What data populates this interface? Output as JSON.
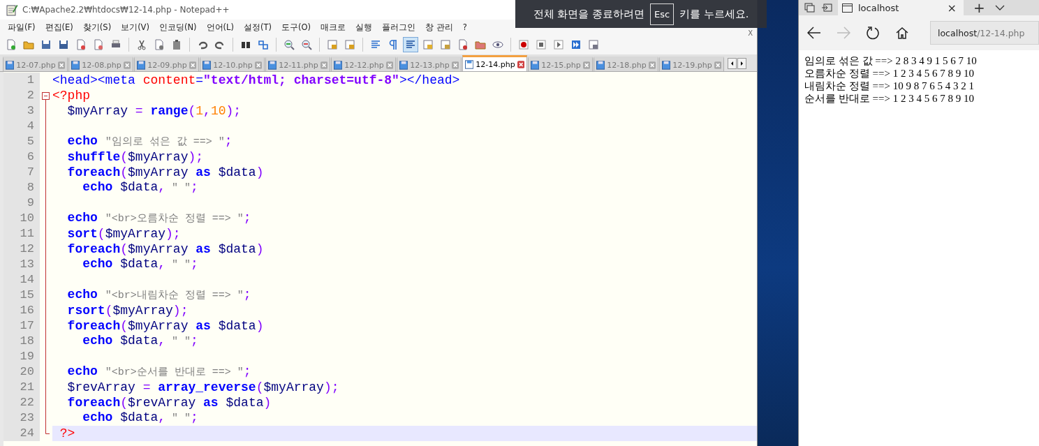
{
  "editor_window": {
    "title": "C:₩Apache2.2₩htdocs₩12-14.php - Notepad++",
    "menu": [
      "파일(F)",
      "편집(E)",
      "찾기(S)",
      "보기(V)",
      "인코딩(N)",
      "언어(L)",
      "설정(T)",
      "도구(O)",
      "매크로",
      "실행",
      "플러그인",
      "창 관리",
      "?"
    ],
    "close_document": "X",
    "tabs": [
      {
        "label": "12-07.php",
        "selected": false
      },
      {
        "label": "12-08.php",
        "selected": false
      },
      {
        "label": "12-09.php",
        "selected": false
      },
      {
        "label": "12-10.php",
        "selected": false
      },
      {
        "label": "12-11.php",
        "selected": false
      },
      {
        "label": "12-12.php",
        "selected": false
      },
      {
        "label": "12-13.php",
        "selected": false
      },
      {
        "label": "12-14.php",
        "selected": true
      },
      {
        "label": "12-15.php",
        "selected": false
      },
      {
        "label": "12-18.php",
        "selected": false
      },
      {
        "label": "12-19.php",
        "selected": false
      }
    ],
    "lines": [
      {
        "number": "1",
        "current": false,
        "code": [
          {
            "text": "<head><meta ",
            "kind": "tag"
          },
          {
            "text": "content",
            "kind": "attr"
          },
          {
            "text": "=",
            "kind": "tag"
          },
          {
            "text": "\"text/html; charset=utf-8\"",
            "kind": "aval"
          },
          {
            "text": "></head>",
            "kind": "tag"
          }
        ]
      },
      {
        "number": "2",
        "current": false,
        "code": [
          {
            "text": "<?php",
            "kind": "php"
          }
        ]
      },
      {
        "number": "3",
        "current": false,
        "code": [
          {
            "text": "  $myArray ",
            "kind": "var"
          },
          {
            "text": "= ",
            "kind": "op"
          },
          {
            "text": "range",
            "kind": "kw"
          },
          {
            "text": "(",
            "kind": "op"
          },
          {
            "text": "1",
            "kind": "num"
          },
          {
            "text": ",",
            "kind": "op"
          },
          {
            "text": "10",
            "kind": "num"
          },
          {
            "text": ");",
            "kind": "op"
          }
        ]
      },
      {
        "number": "4",
        "current": false
      },
      {
        "number": "5",
        "current": false,
        "code": [
          {
            "text": "  echo ",
            "kind": "kw"
          },
          {
            "text": "\"임의로 섞은 값 ==> \"",
            "kind": "str"
          },
          {
            "text": ";",
            "kind": "op"
          }
        ]
      },
      {
        "number": "6",
        "current": false,
        "code": [
          {
            "text": "  shuffle",
            "kind": "kw"
          },
          {
            "text": "(",
            "kind": "op"
          },
          {
            "text": "$myArray",
            "kind": "var"
          },
          {
            "text": ");",
            "kind": "op"
          }
        ]
      },
      {
        "number": "7",
        "current": false,
        "code": [
          {
            "text": "  foreach",
            "kind": "kw"
          },
          {
            "text": "(",
            "kind": "op"
          },
          {
            "text": "$myArray ",
            "kind": "var"
          },
          {
            "text": "as",
            "kind": "kw"
          },
          {
            "text": " $data",
            "kind": "var"
          },
          {
            "text": ")",
            "kind": "op"
          }
        ]
      },
      {
        "number": "8",
        "current": false,
        "code": [
          {
            "text": "    echo",
            "kind": "kw"
          },
          {
            "text": " $data",
            "kind": "var"
          },
          {
            "text": ",",
            "kind": "op"
          },
          {
            "text": " \" \"",
            "kind": "str"
          },
          {
            "text": ";",
            "kind": "op"
          }
        ]
      },
      {
        "number": "9",
        "current": false
      },
      {
        "number": "10",
        "current": false,
        "code": [
          {
            "text": "  echo ",
            "kind": "kw"
          },
          {
            "text": "\"<br>오름차순 정렬 ==> \"",
            "kind": "str"
          },
          {
            "text": ";",
            "kind": "op"
          }
        ]
      },
      {
        "number": "11",
        "current": false,
        "code": [
          {
            "text": "  sort",
            "kind": "kw"
          },
          {
            "text": "(",
            "kind": "op"
          },
          {
            "text": "$myArray",
            "kind": "var"
          },
          {
            "text": ");",
            "kind": "op"
          }
        ]
      },
      {
        "number": "12",
        "current": false,
        "code": [
          {
            "text": "  foreach",
            "kind": "kw"
          },
          {
            "text": "(",
            "kind": "op"
          },
          {
            "text": "$myArray ",
            "kind": "var"
          },
          {
            "text": "as",
            "kind": "kw"
          },
          {
            "text": " $data",
            "kind": "var"
          },
          {
            "text": ")",
            "kind": "op"
          }
        ]
      },
      {
        "number": "13",
        "current": false,
        "code": [
          {
            "text": "    echo",
            "kind": "kw"
          },
          {
            "text": " $data",
            "kind": "var"
          },
          {
            "text": ",",
            "kind": "op"
          },
          {
            "text": " \" \"",
            "kind": "str"
          },
          {
            "text": ";",
            "kind": "op"
          }
        ]
      },
      {
        "number": "14",
        "current": false
      },
      {
        "number": "15",
        "current": false,
        "code": [
          {
            "text": "  echo ",
            "kind": "kw"
          },
          {
            "text": "\"<br>내림차순 정렬 ==> \"",
            "kind": "str"
          },
          {
            "text": ";",
            "kind": "op"
          }
        ]
      },
      {
        "number": "16",
        "current": false,
        "code": [
          {
            "text": "  rsort",
            "kind": "kw"
          },
          {
            "text": "(",
            "kind": "op"
          },
          {
            "text": "$myArray",
            "kind": "var"
          },
          {
            "text": ");",
            "kind": "op"
          }
        ]
      },
      {
        "number": "17",
        "current": false,
        "code": [
          {
            "text": "  foreach",
            "kind": "kw"
          },
          {
            "text": "(",
            "kind": "op"
          },
          {
            "text": "$myArray ",
            "kind": "var"
          },
          {
            "text": "as",
            "kind": "kw"
          },
          {
            "text": " $data",
            "kind": "var"
          },
          {
            "text": ")",
            "kind": "op"
          }
        ]
      },
      {
        "number": "18",
        "current": false,
        "code": [
          {
            "text": "    echo",
            "kind": "kw"
          },
          {
            "text": " $data",
            "kind": "var"
          },
          {
            "text": ",",
            "kind": "op"
          },
          {
            "text": " \" \"",
            "kind": "str"
          },
          {
            "text": ";",
            "kind": "op"
          }
        ]
      },
      {
        "number": "19",
        "current": false
      },
      {
        "number": "20",
        "current": false,
        "code": [
          {
            "text": "  echo ",
            "kind": "kw"
          },
          {
            "text": "\"<br>순서를 반대로 ==> \"",
            "kind": "str"
          },
          {
            "text": ";",
            "kind": "op"
          }
        ]
      },
      {
        "number": "21",
        "current": false,
        "code": [
          {
            "text": "  $revArray ",
            "kind": "var"
          },
          {
            "text": "= ",
            "kind": "op"
          },
          {
            "text": "array_reverse",
            "kind": "kw"
          },
          {
            "text": "(",
            "kind": "op"
          },
          {
            "text": "$myArray",
            "kind": "var"
          },
          {
            "text": ");",
            "kind": "op"
          }
        ]
      },
      {
        "number": "22",
        "current": false,
        "code": [
          {
            "text": "  foreach",
            "kind": "kw"
          },
          {
            "text": "(",
            "kind": "op"
          },
          {
            "text": "$revArray ",
            "kind": "var"
          },
          {
            "text": "as",
            "kind": "kw"
          },
          {
            "text": " $data",
            "kind": "var"
          },
          {
            "text": ")",
            "kind": "op"
          }
        ]
      },
      {
        "number": "23",
        "current": false,
        "code": [
          {
            "text": "    echo",
            "kind": "kw"
          },
          {
            "text": " $data",
            "kind": "var"
          },
          {
            "text": ",",
            "kind": "op"
          },
          {
            "text": " \" \"",
            "kind": "str"
          },
          {
            "text": ";",
            "kind": "op"
          }
        ]
      },
      {
        "number": "24",
        "current": true,
        "code": [
          {
            "text": " ?>",
            "kind": "php"
          }
        ]
      }
    ]
  },
  "fullscreen_notice": {
    "before": "전체 화면을 종료하려면",
    "key": "Esc",
    "after": "키를 누르세요."
  },
  "browser": {
    "tab_title": "localhost",
    "close": "×",
    "new_tab": "+",
    "address": {
      "host": "localhost",
      "path": "/12-14.php"
    },
    "output_lines": [
      "임의로 섞은 값 ==> 2 8 3 4 9 1 5 6 7 10",
      "오름차순 정렬 ==> 1 2 3 4 5 6 7 8 9 10",
      "내림차순 정렬 ==> 10 9 8 7 6 5 4 3 2 1",
      "순서를 반대로 ==> 1 2 3 4 5 6 7 8 9 10"
    ]
  }
}
